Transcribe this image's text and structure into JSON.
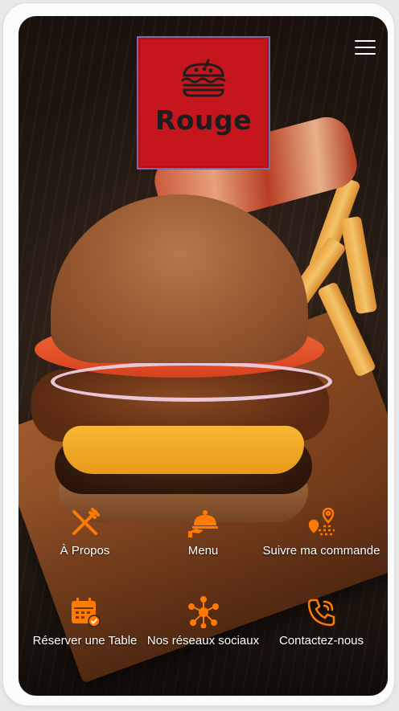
{
  "brand": {
    "name": "Rouge",
    "logo_icon": "burger-icon",
    "logo_color": "#c4161c"
  },
  "header": {
    "menu_icon": "hamburger-menu-icon"
  },
  "accent_color": "#ff7a00",
  "nav": [
    {
      "label": "À Propos",
      "icon": "fork-knife-icon"
    },
    {
      "label": "Menu",
      "icon": "cloche-icon"
    },
    {
      "label": "Suivre ma commande",
      "icon": "delivery-route-icon"
    },
    {
      "label": "Réserver une Table",
      "icon": "calendar-check-icon"
    },
    {
      "label": "Nos réseaux sociaux",
      "icon": "network-icon"
    },
    {
      "label": "Contactez-nous",
      "icon": "phone-icon"
    }
  ]
}
